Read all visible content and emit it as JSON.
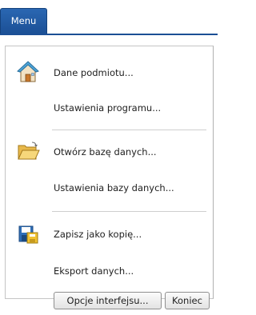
{
  "tab": {
    "label": "Menu"
  },
  "items": [
    {
      "label": "Dane podmiotu...",
      "icon": "home-icon"
    },
    {
      "label": "Ustawienia programu...",
      "icon": ""
    },
    {
      "label": "Otwórz bazę danych...",
      "icon": "folder-open-icon"
    },
    {
      "label": "Ustawienia bazy danych...",
      "icon": ""
    },
    {
      "label": "Zapisz jako kopię...",
      "icon": "save-copy-icon"
    },
    {
      "label": "Eksport danych...",
      "icon": ""
    }
  ],
  "buttons": {
    "options_label": "Opcje interfejsu...",
    "exit_label": "Koniec"
  },
  "colors": {
    "accent": "#1b4f95",
    "separator": "#cfcfcf"
  }
}
